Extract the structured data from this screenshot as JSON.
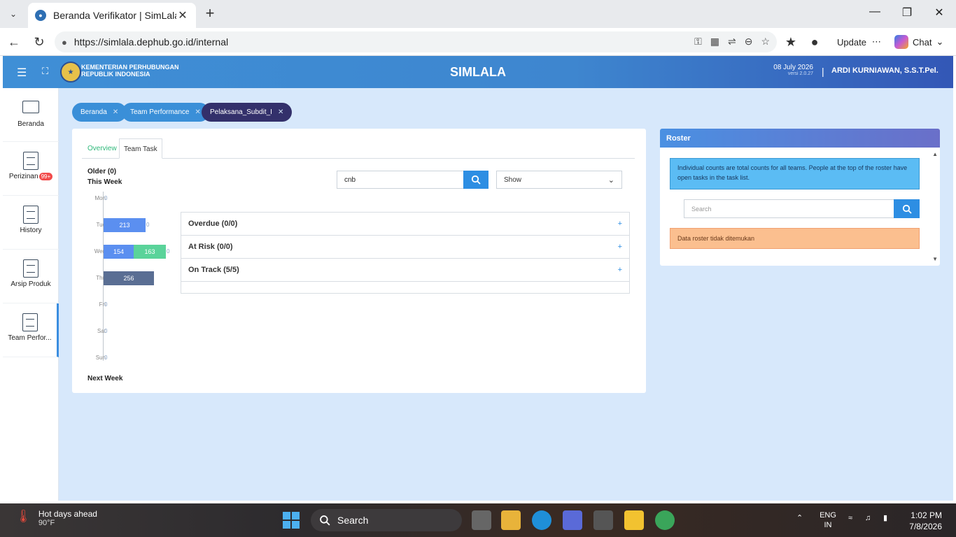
{
  "browser": {
    "tab_title": "Beranda Verifikator | SimLala",
    "url": "https://simlala.dephub.go.id/internal",
    "update_label": "Update",
    "chat_label": "Chat"
  },
  "header": {
    "ministry_line1": "KEMENTERIAN PERHUBUNGAN",
    "ministry_line2": "REPUBLIK INDONESIA",
    "app_title": "SIMLALA",
    "date": "08 July 2026",
    "version": "versi 2.0.27",
    "separator": "|",
    "user": "ARDI KURNIAWAN, S.S.T.Pel."
  },
  "sidebar": {
    "items": [
      {
        "label": "Beranda"
      },
      {
        "label": "Perizinan",
        "badge": "99+"
      },
      {
        "label": "History"
      },
      {
        "label": "Arsip Produk"
      },
      {
        "label": "Team Perfor..."
      }
    ]
  },
  "breadcrumbs": [
    {
      "label": "Beranda"
    },
    {
      "label": "Team Performance"
    },
    {
      "label": "Pelaksana_Subdit_I"
    }
  ],
  "main": {
    "tabs": [
      {
        "label": "Overview"
      },
      {
        "label": "Team Task"
      }
    ],
    "older": "Older (0)",
    "this_week": "This Week",
    "next_week": "Next Week",
    "search_value": "cnb",
    "show_select": "Show",
    "accordion": [
      {
        "label": "Overdue (0/0)"
      },
      {
        "label": "At Risk (0/0)"
      },
      {
        "label": "On Track (5/5)"
      }
    ],
    "plus": "+"
  },
  "chart_data": {
    "type": "bar",
    "orientation": "horizontal",
    "stacked": true,
    "categories": [
      "Mon",
      "Tue",
      "Wed",
      "Thu",
      "Fri",
      "Sat",
      "Sun"
    ],
    "series": [
      {
        "values": [
          0,
          213,
          154,
          256,
          0,
          0,
          0
        ],
        "color": "#5b8ff0"
      },
      {
        "values": [
          0,
          0,
          163,
          0,
          0,
          0,
          0
        ],
        "color": "#5ad39a"
      }
    ],
    "value_labels": [
      "0",
      "213",
      "154",
      "163",
      "256",
      "0",
      "0",
      "0"
    ]
  },
  "roster": {
    "title": "Roster",
    "info": "Individual counts are total counts for all teams. People at the top of the roster have open tasks in the task list.",
    "search_placeholder": "Search",
    "empty": "Data roster tidak ditemukan"
  },
  "taskbar": {
    "weather_title": "Hot days ahead",
    "weather_temp": "90°F",
    "search": "Search",
    "lang1": "ENG",
    "lang2": "IN",
    "time": "1:02 PM",
    "date": "7/8/2026"
  }
}
